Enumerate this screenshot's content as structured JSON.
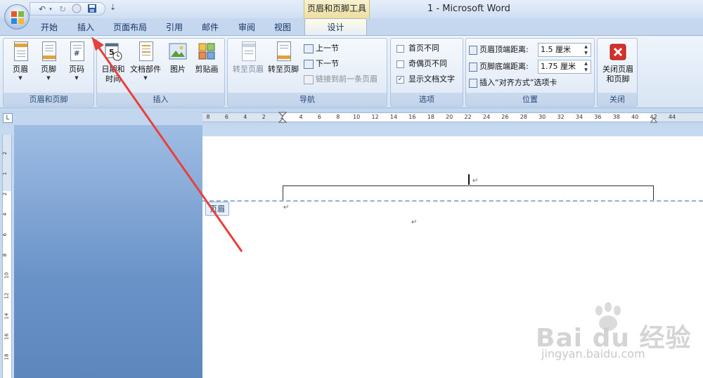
{
  "titlebar": {
    "window_title": "1 - Microsoft Word",
    "context_tool_label": "页眉和页脚工具",
    "qat": {
      "undo_icon": "undo-icon",
      "redo_icon": "redo-icon",
      "save_icon": "save-icon",
      "more_icon": "customize-qat-icon",
      "more_glyph": "⇣"
    }
  },
  "tabs": [
    {
      "label": "开始"
    },
    {
      "label": "插入"
    },
    {
      "label": "页面布局"
    },
    {
      "label": "引用"
    },
    {
      "label": "邮件"
    },
    {
      "label": "审阅"
    },
    {
      "label": "视图"
    },
    {
      "label": "设计"
    }
  ],
  "ribbon": {
    "group_header_footer": {
      "label": "页眉和页脚",
      "buttons": [
        {
          "label": "页眉"
        },
        {
          "label": "页脚"
        },
        {
          "label": "页码"
        }
      ]
    },
    "group_insert": {
      "label": "插入",
      "buttons": [
        {
          "label_line1": "日期和",
          "label_line2": "时间"
        },
        {
          "label": "文档部件"
        },
        {
          "label": "图片"
        },
        {
          "label": "剪贴画"
        }
      ]
    },
    "group_nav": {
      "label": "导航",
      "goto_header": "转至页眉",
      "goto_footer": "转至页脚",
      "prev_section": "上一节",
      "next_section": "下一节",
      "link_previous": "链接到前一条页眉"
    },
    "group_options": {
      "label": "选项",
      "diff_first": "首页不同",
      "diff_odd_even": "奇偶页不同",
      "show_doc_text": "显示文档文字",
      "show_doc_text_checked": true
    },
    "group_position": {
      "label": "位置",
      "header_from_top_label": "页眉顶端距离:",
      "header_from_top_value": "1.5 厘米",
      "footer_from_bottom_label": "页脚底端距离:",
      "footer_from_bottom_value": "1.75 厘米",
      "insert_align_tab": "插入“对齐方式”选项卡"
    },
    "group_close": {
      "label": "关闭",
      "close_line1": "关闭页眉",
      "close_line2": "和页脚"
    }
  },
  "ruler": {
    "corner_glyph": "L",
    "h_ticks": [
      "8",
      "6",
      "4",
      "2",
      "2",
      "4",
      "6",
      "8",
      "10",
      "12",
      "14",
      "16",
      "18",
      "20",
      "22",
      "24",
      "26",
      "28",
      "30",
      "32",
      "34",
      "36",
      "38",
      "40",
      "42",
      "44"
    ],
    "v_ticks": [
      "2",
      "1",
      "2",
      "4",
      "6",
      "8",
      "10",
      "12",
      "14",
      "16",
      "18"
    ]
  },
  "document": {
    "header_tag": "页眉",
    "para_mark": "↵"
  },
  "colors": {
    "annotation_arrow": "#e8413b",
    "ribbon_bg": "#dce8f6",
    "workspace_blue": "#6a93c8"
  },
  "watermark": {
    "main": "Bai du 经验",
    "url": "jingyan.baidu.com"
  }
}
